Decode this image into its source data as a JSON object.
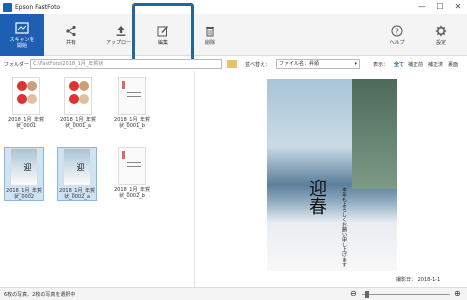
{
  "app": {
    "title": "Epson FastFoto"
  },
  "window": {
    "minimize": "—",
    "maximize": "☐",
    "close": "✕"
  },
  "toolbar": {
    "scan_label": "スキャンを開始",
    "share_label": "共有",
    "upload_label": "アップロード",
    "edit_label": "編集",
    "delete_label": "削除",
    "help_label": "ヘルプ",
    "settings_label": "設定"
  },
  "pathbar": {
    "folder_label": "フォルダー：",
    "folder_path": "C:\\FastFoto\\2018_1月_年賀状",
    "sort_label": "並べ替え：",
    "sort_value": "ファイル名：昇順",
    "view_label": "表示：",
    "view_options": [
      "全て",
      "補正前",
      "補正済",
      "裏面"
    ]
  },
  "thumbnails": [
    {
      "caption": "2018_1月_年賀状_0001"
    },
    {
      "caption": "2018_1月_年賀状_0001_a"
    },
    {
      "caption": "2018_1月_年賀状_0001_b"
    },
    {
      "caption": "2018_1月_年賀状_0002"
    },
    {
      "caption": "2018_1月_年賀状_0002_a"
    },
    {
      "caption": "2018_1月_年賀状_0002_b"
    }
  ],
  "preview": {
    "card_main_text": "迎春",
    "card_sub_text": "本年もよろしくお願い申し上げます",
    "shoot_date": "撮影日： 2018-1-1"
  },
  "status": {
    "text": "6枚の写真、2枚の写真を選択中"
  },
  "colors": {
    "accent": "#1e5fb4",
    "highlight_box": "#21679e"
  }
}
